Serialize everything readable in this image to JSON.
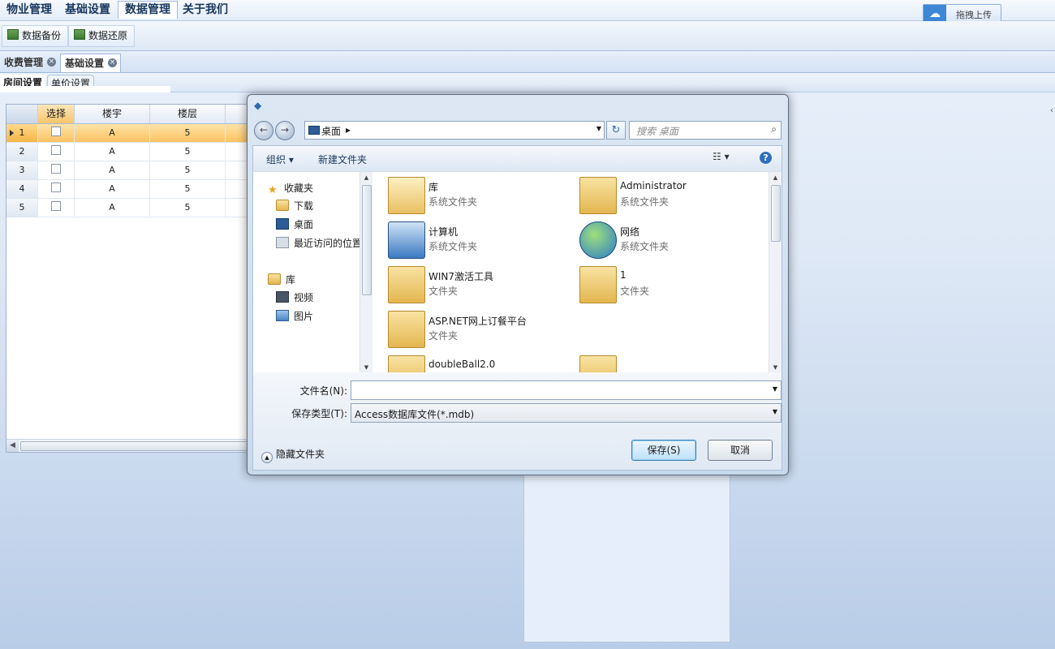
{
  "menu": {
    "items": [
      "物业管理",
      "基础设置",
      "数据管理",
      "关于我们"
    ],
    "active_index": 2
  },
  "upload": {
    "label": "拖拽上传"
  },
  "toolbar": {
    "backup": "数据备份",
    "restore": "数据还原"
  },
  "tabs": [
    {
      "label": "收费管理"
    },
    {
      "label": "基础设置"
    }
  ],
  "subtabs": [
    {
      "label": "房间设置"
    },
    {
      "label": "单价设置"
    }
  ],
  "grid": {
    "columns": [
      "选择",
      "楼宇",
      "楼层"
    ],
    "rows": [
      {
        "num": "1",
        "building": "A",
        "floor": "5"
      },
      {
        "num": "2",
        "building": "A",
        "floor": "5"
      },
      {
        "num": "3",
        "building": "A",
        "floor": "5"
      },
      {
        "num": "4",
        "building": "A",
        "floor": "5"
      },
      {
        "num": "5",
        "building": "A",
        "floor": "5"
      }
    ]
  },
  "dialog": {
    "address": "桌面",
    "search_placeholder": "搜索 桌面",
    "organize": "组织 ▾",
    "new_folder": "新建文件夹",
    "nav": {
      "favorites": "收藏夹",
      "downloads": "下载",
      "desktop": "桌面",
      "recent": "最近访问的位置",
      "libraries": "库",
      "videos": "视频",
      "pictures": "图片"
    },
    "files": [
      {
        "name": "库",
        "type": "系统文件夹",
        "icon": "library-icon"
      },
      {
        "name": "Administrator",
        "type": "系统文件夹",
        "icon": "user-folder-icon"
      },
      {
        "name": "计算机",
        "type": "系统文件夹",
        "icon": "computer-icon"
      },
      {
        "name": "网络",
        "type": "系统文件夹",
        "icon": "network-icon"
      },
      {
        "name": "WIN7激活工具",
        "type": "文件夹",
        "icon": "folder-icon"
      },
      {
        "name": "1",
        "type": "文件夹",
        "icon": "folder-icon"
      },
      {
        "name": "ASP.NET网上订餐平台",
        "type": "文件夹",
        "icon": "folder-icon"
      },
      {
        "name": "doubleBall2.0",
        "type": "",
        "icon": "folder-icon"
      }
    ],
    "filename_label": "文件名(N):",
    "filename_value": "",
    "filetype_label": "保存类型(T):",
    "filetype_value": "Access数据库文件(*.mdb)",
    "hide_folders": "隐藏文件夹",
    "save": "保存(S)",
    "cancel": "取消"
  }
}
